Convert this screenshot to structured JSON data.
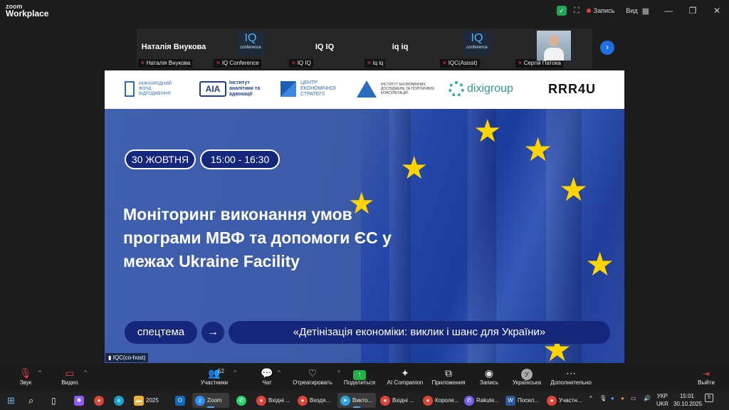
{
  "titlebar": {
    "logo_line1": "zoom",
    "logo_line2": "Workplace",
    "record_label": "Запись",
    "view_label": "Вид",
    "icons": [
      "shield-check-icon",
      "expand-icon",
      "minimize-icon",
      "restore-icon",
      "close-icon"
    ]
  },
  "participants": [
    {
      "big_name": "Наталія Внукова",
      "caption": "Наталія Внукова"
    },
    {
      "logo_text": "IQ",
      "logo_sub": "conference",
      "caption": "IQ Conference"
    },
    {
      "big_name": "IQ IQ",
      "caption": "IQ IQ"
    },
    {
      "big_name": "iq iq",
      "caption": "iq iq"
    },
    {
      "logo_text": "IQ",
      "logo_sub": "conference",
      "caption": "IQC(Asisst)"
    },
    {
      "caption": "Сергій Патока"
    }
  ],
  "slide": {
    "sponsors": {
      "s1": "МІЖНАРОДНИЙ ФОНД ВІДРОДЖЕННЯ",
      "s2_mark": "AIA",
      "s2": "Інститут аналітики та адвокації",
      "s3": "ЦЕНТР ЕКОНОМІЧНОЇ СТРАТЕГІЇ",
      "s4": "ІНСТИТУТ ЕКОНОМІЧНИХ ДОСЛІДЖЕНЬ ТА ПОЛІТИЧНИХ КОНСУЛЬТАЦІЙ",
      "s5": "dixigroup",
      "s6": "RRR4U"
    },
    "date": "30 ЖОВТНЯ",
    "time": "15:00 - 16:30",
    "headline": "Моніторинг виконання умов програми МВФ та допомоги ЄС у межах Ukraine Facility",
    "tag": "спецтема",
    "arrow": "→",
    "quote": "«Детінізація економіки: виклик і шанс для України»"
  },
  "host_label": "IQC(co-host)",
  "controls": {
    "audio": "Звук",
    "video": "Видео",
    "participants": "Участники",
    "participants_count": "52",
    "chat": "Чат",
    "react": "Отреагировать",
    "share": "Поделиться",
    "ai": "AI Companion",
    "apps": "Приложения",
    "record": "Запись",
    "lang": "Українська",
    "lang_initial": "У",
    "more": "Дополнительно",
    "leave": "Выйти"
  },
  "taskbar": {
    "items": [
      {
        "label": "2025",
        "color": "#e8b13c"
      },
      {
        "label": "Zoom",
        "color": "#2d8cff"
      },
      {
        "label": "Вхідні ...",
        "color": "#db4437"
      },
      {
        "label": "Входя...",
        "color": "#db4437"
      },
      {
        "label": "Викто...",
        "color": "#2aa3e0"
      },
      {
        "label": "Вхідні ...",
        "color": "#db4437"
      },
      {
        "label": "Короле...",
        "color": "#db4437"
      },
      {
        "label": "Rakute...",
        "color": "#7360f2"
      },
      {
        "label": "Посил...",
        "color": "#2b579a"
      },
      {
        "label": "Участн...",
        "color": "#db4437"
      }
    ],
    "lang_top": "УКР",
    "lang_bottom": "UKR",
    "time": "15:01",
    "date": "30.10.2025",
    "badge": "5"
  }
}
